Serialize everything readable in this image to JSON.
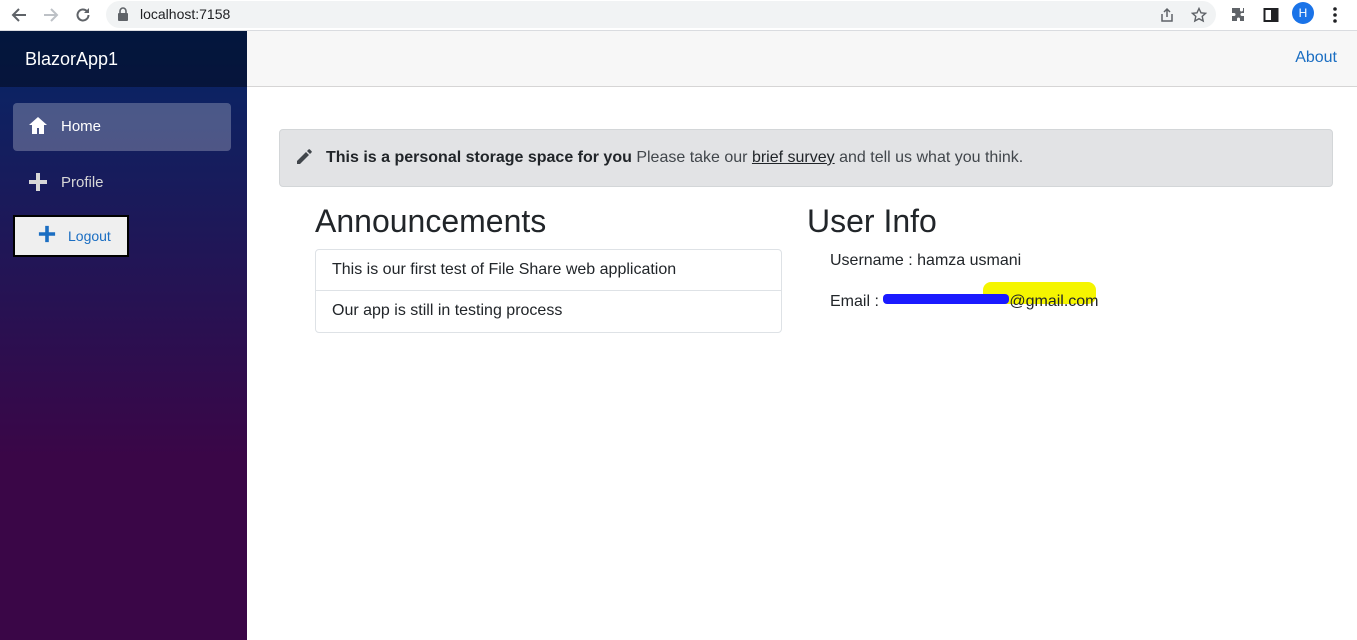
{
  "browser": {
    "url": "localhost:7158",
    "profile_initial": "H"
  },
  "sidebar": {
    "brand": "BlazorApp1",
    "items": [
      {
        "label": "Home",
        "icon": "home-icon",
        "active": true
      },
      {
        "label": "Profile",
        "icon": "plus-icon",
        "active": false
      }
    ],
    "logout_label": "Logout"
  },
  "top_row": {
    "about_label": "About"
  },
  "alert": {
    "bold_text": "This is a personal storage space for you",
    "text_before_link": " Please take our ",
    "link_text": "brief survey",
    "text_after_link": " and tell us what you think."
  },
  "announcements": {
    "title": "Announcements",
    "items": [
      "This is our first test of File Share web application",
      "Our app is still in testing process"
    ]
  },
  "user_info": {
    "title": "User Info",
    "username_line": "Username : hamza usmani",
    "email_label": "Email : ",
    "email_visible_suffix": "@gmail.com"
  },
  "colors": {
    "accent": "#1b6ec2",
    "sidebar_top": "#052767",
    "sidebar_bottom": "#3a0647"
  }
}
